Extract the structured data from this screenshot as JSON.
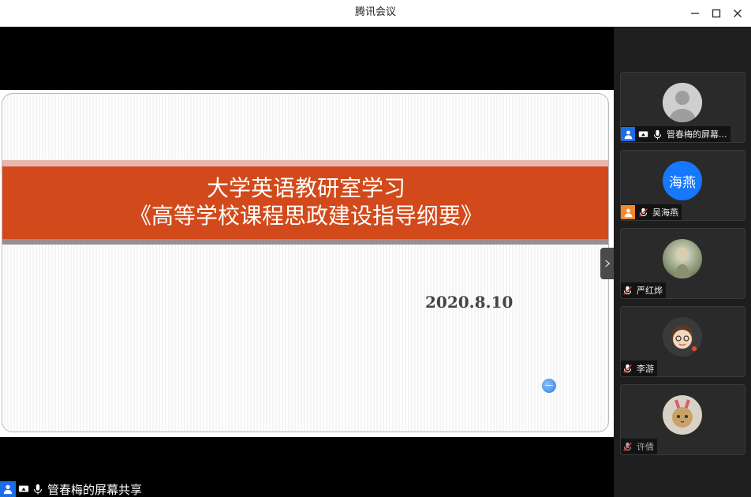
{
  "window": {
    "title": "腾讯会议"
  },
  "slide": {
    "title_line1": "大学英语教研室学习",
    "title_line2": "《高等学校课程思政建设指导纲要》",
    "date": "2020.8.10"
  },
  "share_label": "管春梅的屏幕共享",
  "participants": [
    {
      "name": "管春梅的屏幕...",
      "avatar_text": ""
    },
    {
      "name": "吴海燕",
      "avatar_text": "海燕"
    },
    {
      "name": "严红烨",
      "avatar_text": ""
    },
    {
      "name": "李游",
      "avatar_text": ""
    },
    {
      "name": "许倩",
      "avatar_text": ""
    }
  ],
  "colors": {
    "band": "#d24a1b",
    "accent_blue": "#1c6ee8",
    "host_orange": "#f5882a",
    "avatar_blue": "#1677ff"
  }
}
